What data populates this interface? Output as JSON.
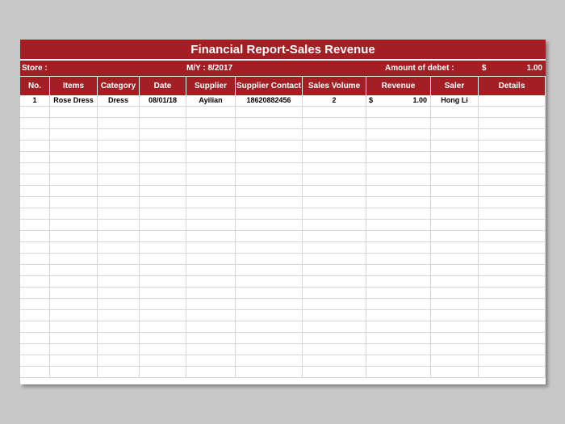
{
  "report": {
    "title": "Financial Report-Sales Revenue",
    "store_label": "Store :",
    "month_year": "M/Y : 8/2017",
    "amount_debet_label": "Amount of debet :",
    "amount_debet_currency": "$",
    "amount_debet_value": "1.00"
  },
  "table": {
    "columns": [
      "No.",
      "Items",
      "Category",
      "Date",
      "Supplier",
      "Supplier Contact",
      "Sales Volume",
      "Revenue",
      "Saler",
      "Details"
    ],
    "rows": [
      {
        "no": "1",
        "items": "Rose Dress",
        "category": "Dress",
        "date": "08/01/18",
        "supplier": "Ayilian",
        "supplier_contact": "18620882456",
        "sales_volume": "2",
        "revenue_currency": "$",
        "revenue": "1.00",
        "saler": "Hong Li",
        "details": ""
      }
    ],
    "empty_rows": 24
  },
  "colors": {
    "header_red": "#a31f24",
    "background": "#c8c8c8",
    "gridline": "#d6d6d6"
  }
}
